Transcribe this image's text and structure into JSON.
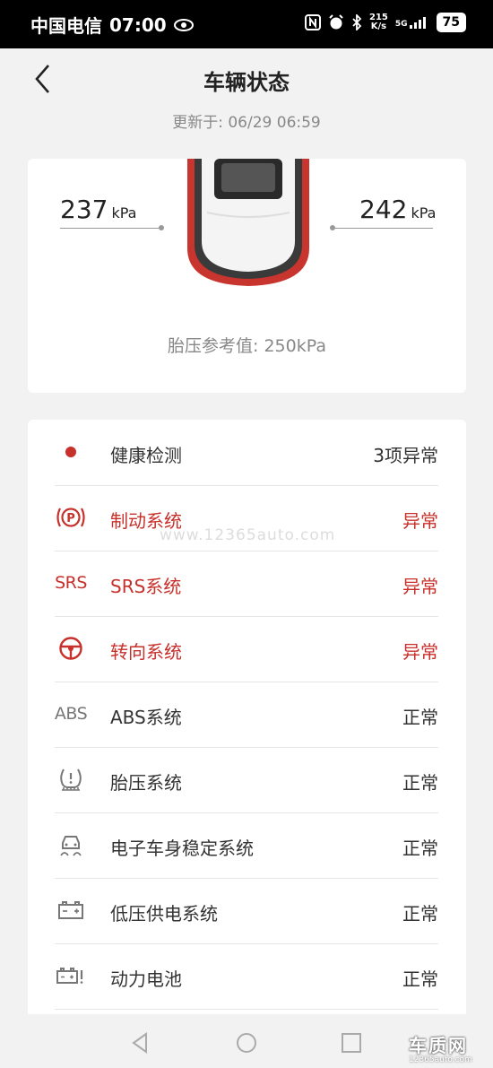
{
  "status_bar": {
    "carrier": "中国电信",
    "time": "07:00",
    "net_speed_value": "215",
    "net_speed_unit": "K/s",
    "network": "5G",
    "battery": "75"
  },
  "header": {
    "title": "车辆状态",
    "updated": "更新于: 06/29 06:59"
  },
  "tire": {
    "left_value": "237",
    "left_unit": "kPa",
    "right_value": "242",
    "right_unit": "kPa",
    "reference": "胎压参考值: 250kPa"
  },
  "systems": [
    {
      "label": "健康检测",
      "status": "3项异常",
      "icon": "red-dot-icon"
    },
    {
      "label": "制动系统",
      "status": "异常",
      "icon": "parking-brake-icon"
    },
    {
      "label": "SRS系统",
      "status": "异常",
      "icon": "srs-icon",
      "icon_text": "SRS"
    },
    {
      "label": "转向系统",
      "status": "异常",
      "icon": "steering-wheel-icon"
    },
    {
      "label": "ABS系统",
      "status": "正常",
      "icon": "abs-icon",
      "icon_text": "ABS"
    },
    {
      "label": "胎压系统",
      "status": "正常",
      "icon": "tire-pressure-icon"
    },
    {
      "label": "电子车身稳定系统",
      "status": "正常",
      "icon": "stability-control-icon"
    },
    {
      "label": "低压供电系统",
      "status": "正常",
      "icon": "battery-icon"
    },
    {
      "label": "动力电池",
      "status": "正常",
      "icon": "power-battery-icon"
    }
  ],
  "watermark": "www.12365auto.com",
  "logo": {
    "main": "车质网",
    "sub": "12365auto.com"
  },
  "colors": {
    "alert": "#c7302b",
    "normal": "#333333",
    "background": "#f2f2f2"
  }
}
